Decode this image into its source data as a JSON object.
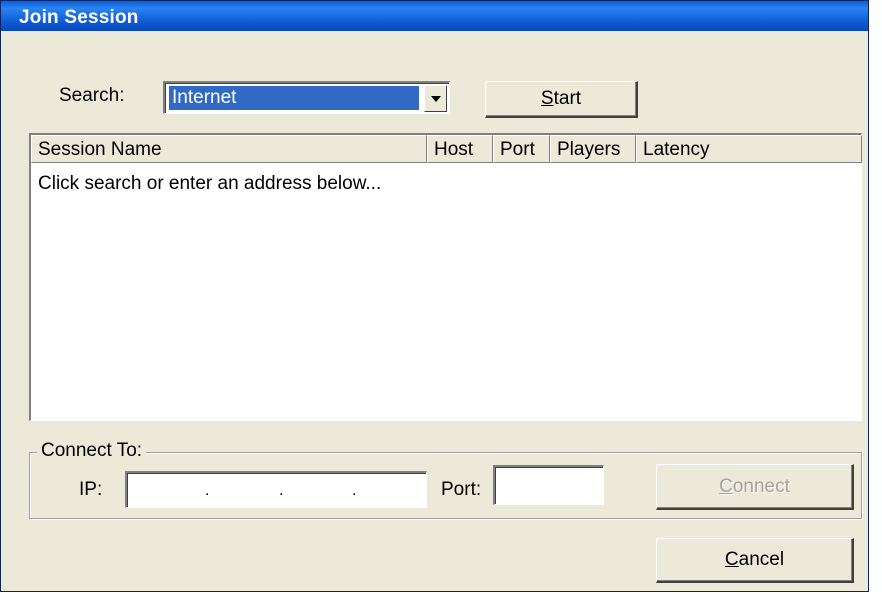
{
  "window": {
    "title": "Join Session"
  },
  "search": {
    "label": "Search:",
    "selected": "Internet",
    "start_button": {
      "pre": "",
      "accel": "S",
      "post": "tart"
    }
  },
  "sessions": {
    "columns": [
      "Session Name",
      "Host",
      "Port",
      "Players",
      "Latency"
    ],
    "empty_message": "Click search or enter an address below..."
  },
  "connect": {
    "group_label": "Connect To:",
    "ip_label": "IP:",
    "ip_separators": [
      ".",
      ".",
      "."
    ],
    "port_label": "Port:",
    "port_value": "",
    "connect_button": {
      "accel": "C",
      "post": "onnect"
    },
    "connect_enabled": false
  },
  "cancel_button": {
    "accel": "C",
    "post": "ancel"
  },
  "colors": {
    "title_bar": "#0a5fd8",
    "dialog_bg": "#ece9d8",
    "selection": "#316ac5"
  }
}
